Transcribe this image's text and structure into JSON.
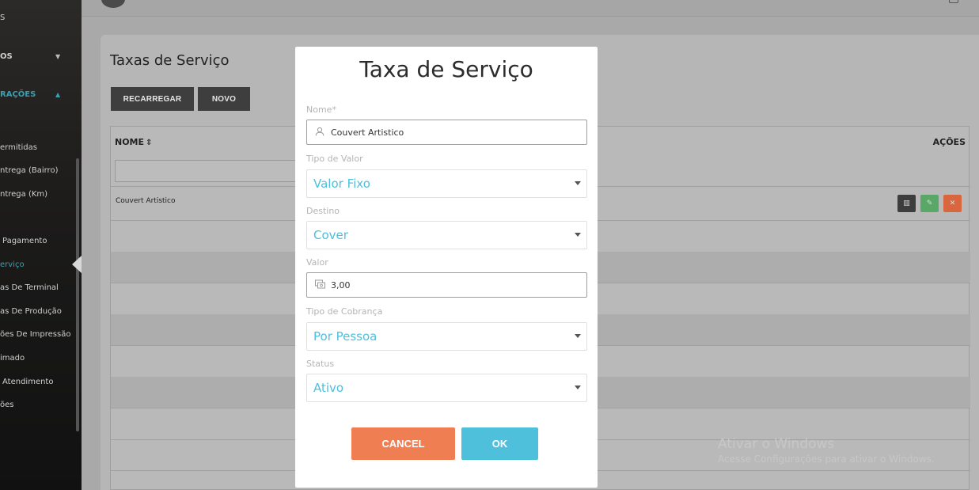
{
  "sidebar": {
    "items": [
      {
        "label": "S"
      },
      {
        "label": "OS"
      },
      {
        "label": "RAÇÕES"
      },
      {
        "label": "ermitidas"
      },
      {
        "label": "ntrega (Bairro)"
      },
      {
        "label": "ntrega (Km)"
      },
      {
        "label": "Pagamento"
      },
      {
        "label": "erviço"
      },
      {
        "label": "as De Terminal"
      },
      {
        "label": "as De Produção"
      },
      {
        "label": "ões De Impressão"
      },
      {
        "label": "imado"
      },
      {
        "label": "Atendimento"
      },
      {
        "label": "ões"
      }
    ],
    "active_color": "#3a9fb0"
  },
  "page": {
    "title": "Taxas de Serviço",
    "buttons": {
      "reload": "RECARREGAR",
      "new": "NOVO"
    }
  },
  "table": {
    "columns": {
      "name": "NOME",
      "actions": "AÇÕES"
    },
    "rows": [
      {
        "name": "Couvert Artistico"
      }
    ]
  },
  "watermark": {
    "line1": "Ativar o Windows",
    "line2": "Acesse Configurações para ativar o Windows."
  },
  "modal": {
    "title": "Taxa de Serviço",
    "fields": {
      "nome": {
        "label": "Nome*",
        "value": "Couvert Artistico",
        "icon": "user-icon"
      },
      "tipo_valor": {
        "label": "Tipo de Valor",
        "value": "Valor Fixo"
      },
      "destino": {
        "label": "Destino",
        "value": "Cover"
      },
      "valor": {
        "label": "Valor",
        "value": "3,00",
        "icon": "money-icon"
      },
      "tipo_cobranca": {
        "label": "Tipo de Cobrança",
        "value": "Por Pessoa"
      },
      "status": {
        "label": "Status",
        "value": "Ativo"
      }
    },
    "cancel_label": "CANCEL",
    "ok_label": "OK",
    "colors": {
      "cancel": "#ef7f53",
      "ok": "#4fc0dc",
      "select_text": "#4cc0dc"
    }
  }
}
